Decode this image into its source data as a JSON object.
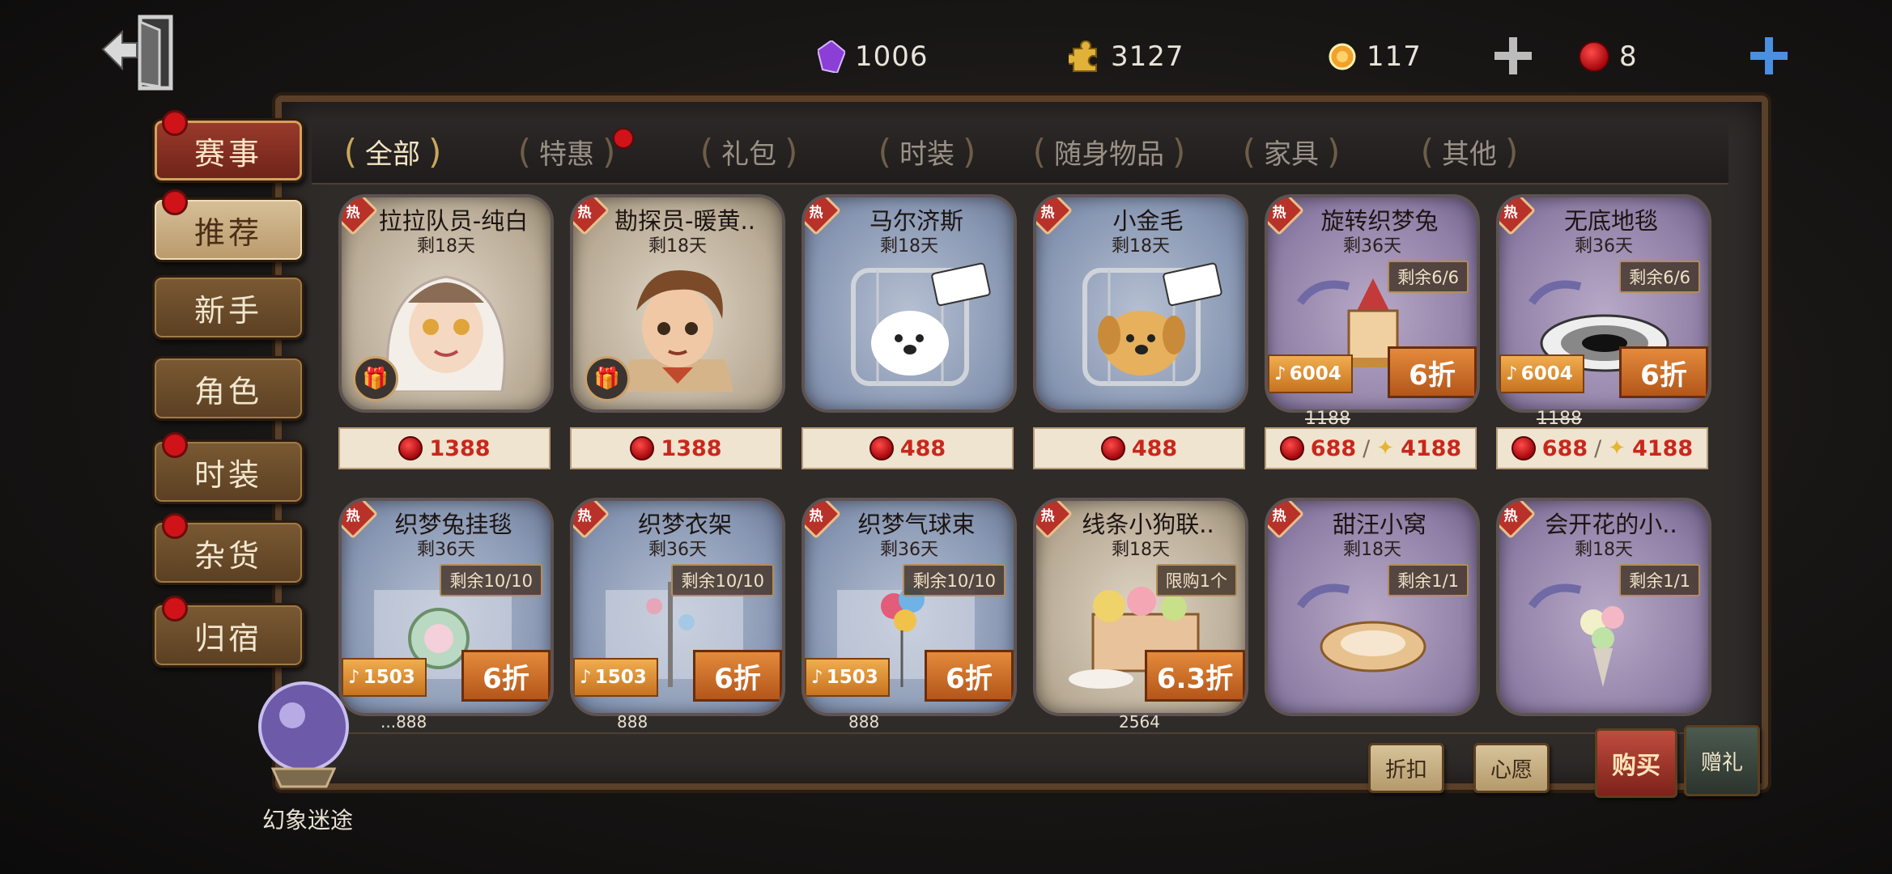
{
  "currencies": [
    {
      "icon": "purple-crystal-icon",
      "value": "1006"
    },
    {
      "icon": "puzzle-piece-icon",
      "value": "3127"
    },
    {
      "icon": "gold-medal-icon",
      "value": "117"
    },
    {
      "icon": "red-coin-icon",
      "value": "8"
    }
  ],
  "tabs": [
    {
      "label": "全部",
      "active": true,
      "dot": false
    },
    {
      "label": "特惠",
      "active": false,
      "dot": true
    },
    {
      "label": "礼包",
      "active": false,
      "dot": false
    },
    {
      "label": "时装",
      "active": false,
      "dot": false
    },
    {
      "label": "随身物品",
      "active": false,
      "dot": false
    },
    {
      "label": "家具",
      "active": false,
      "dot": false
    },
    {
      "label": "其他",
      "active": false,
      "dot": false
    }
  ],
  "side_nav": [
    {
      "label": "赛事",
      "style": "active",
      "dot": true
    },
    {
      "label": "推荐",
      "style": "light",
      "dot": true
    },
    {
      "label": "新手",
      "style": "normal",
      "dot": false
    },
    {
      "label": "角色",
      "style": "normal",
      "dot": false
    },
    {
      "label": "时装",
      "style": "normal",
      "dot": true
    },
    {
      "label": "杂货",
      "style": "normal",
      "dot": true
    },
    {
      "label": "归宿",
      "style": "normal",
      "dot": true
    }
  ],
  "hot_label": "热",
  "row1": [
    {
      "name": "拉拉队员-纯白",
      "days": "剩18天",
      "theme": "sand",
      "art": "character-white-hood-icon",
      "gift": true,
      "price": "1388",
      "orig": "",
      "notes": "",
      "discount": "",
      "stock": "",
      "clue": ""
    },
    {
      "name": "勘探员-暖黄..",
      "days": "剩18天",
      "theme": "sand",
      "art": "character-explorer-icon",
      "gift": true,
      "price": "1388",
      "orig": "",
      "notes": "",
      "discount": "",
      "stock": "",
      "clue": ""
    },
    {
      "name": "马尔济斯",
      "days": "剩18天",
      "theme": "blue",
      "art": "white-dog-cage-icon",
      "gift": false,
      "price": "488",
      "orig": "",
      "notes": "",
      "discount": "",
      "stock": "",
      "clue": ""
    },
    {
      "name": "小金毛",
      "days": "剩18天",
      "theme": "blue",
      "art": "golden-dog-cage-icon",
      "gift": false,
      "price": "488",
      "orig": "",
      "notes": "",
      "discount": "",
      "stock": "",
      "clue": ""
    },
    {
      "name": "旋转织梦兔",
      "days": "剩36天",
      "theme": "violet",
      "art": "carousel-icon",
      "gift": false,
      "price": "688",
      "orig": "1188",
      "notes": "6004",
      "discount": "6折",
      "stock": "剩余6/6",
      "clue": "4188"
    },
    {
      "name": "无底地毯",
      "days": "剩36天",
      "theme": "violet",
      "art": "checker-carpet-icon",
      "gift": false,
      "price": "688",
      "orig": "1188",
      "notes": "6004",
      "discount": "6折",
      "stock": "剩余6/6",
      "clue": "4188"
    }
  ],
  "row2": [
    {
      "name": "织梦兔挂毯",
      "days": "剩36天",
      "theme": "blue",
      "art": "bunny-tapestry-icon",
      "notes": "1503",
      "discount": "6折",
      "stock": "剩余10/10",
      "below": "...888"
    },
    {
      "name": "织梦衣架",
      "days": "剩36天",
      "theme": "blue",
      "art": "coat-rack-icon",
      "notes": "1503",
      "discount": "6折",
      "stock": "剩余10/10",
      "below": "888"
    },
    {
      "name": "织梦气球束",
      "days": "剩36天",
      "theme": "blue",
      "art": "balloon-bunch-icon",
      "notes": "1503",
      "discount": "6折",
      "stock": "剩余10/10",
      "below": "888"
    },
    {
      "name": "线条小狗联..",
      "days": "剩18天",
      "theme": "sand",
      "art": "gift-box-icon",
      "notes": "",
      "discount": "6.3折",
      "stock": "限购1个",
      "below": "2564"
    },
    {
      "name": "甜汪小窝",
      "days": "剩18天",
      "theme": "violet",
      "art": "dog-bed-icon",
      "notes": "",
      "discount": "",
      "stock": "剩余1/1",
      "below": ""
    },
    {
      "name": "会开花的小..",
      "days": "剩18天",
      "theme": "violet",
      "art": "flower-bouquet-icon",
      "notes": "",
      "discount": "",
      "stock": "剩余1/1",
      "below": ""
    }
  ],
  "bottom": {
    "crystal_label": "幻象迷途",
    "discount_btn": "折扣",
    "wish_btn": "心愿",
    "buy_btn": "购买",
    "gift_btn": "赠礼"
  }
}
